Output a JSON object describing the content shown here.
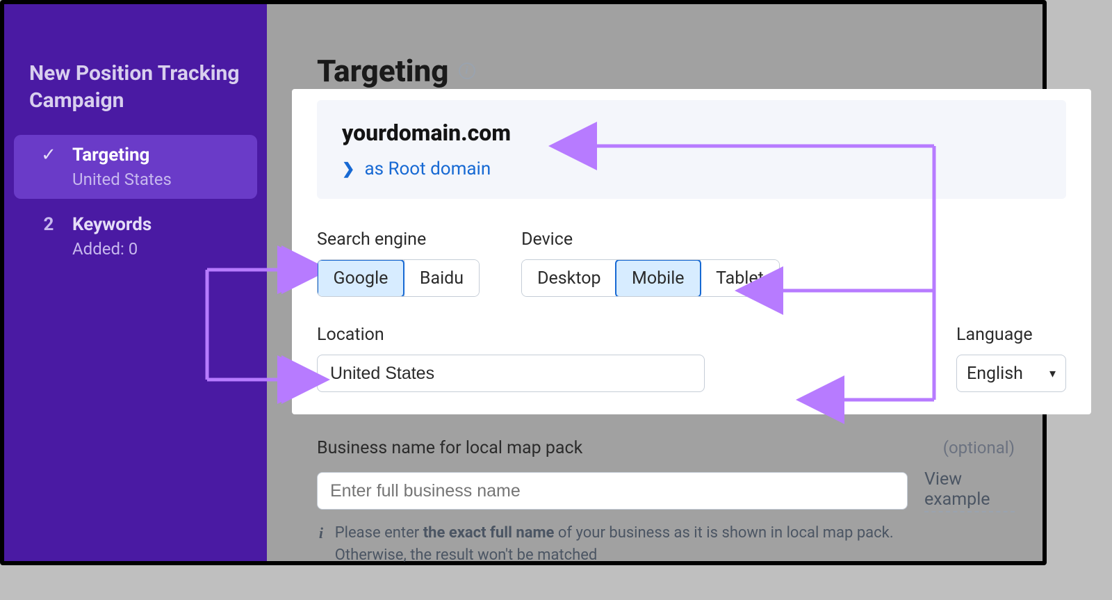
{
  "sidebar": {
    "title": "New Position Tracking Campaign",
    "steps": [
      {
        "icon": "check",
        "name": "Targeting",
        "sub": "United States",
        "active": true
      },
      {
        "icon": "num",
        "num": "2",
        "name": "Keywords",
        "sub": "Added: 0",
        "active": false
      }
    ]
  },
  "page": {
    "title": "Targeting"
  },
  "domain": {
    "name": "yourdomain.com",
    "type_label": "as Root domain"
  },
  "search_engine": {
    "label": "Search engine",
    "options": [
      "Google",
      "Baidu"
    ],
    "selected": "Google"
  },
  "device": {
    "label": "Device",
    "options": [
      "Desktop",
      "Mobile",
      "Tablet"
    ],
    "selected": "Mobile"
  },
  "location": {
    "label": "Location",
    "value": "United States"
  },
  "language": {
    "label": "Language",
    "value": "English"
  },
  "business": {
    "label": "Business name for local map pack",
    "optional": "(optional)",
    "placeholder": "Enter full business name",
    "view_example": "View example",
    "hint_pre": "Please enter ",
    "hint_bold": "the exact full name",
    "hint_post": " of your business as it is shown in local map pack. Otherwise, the result won't be matched"
  }
}
